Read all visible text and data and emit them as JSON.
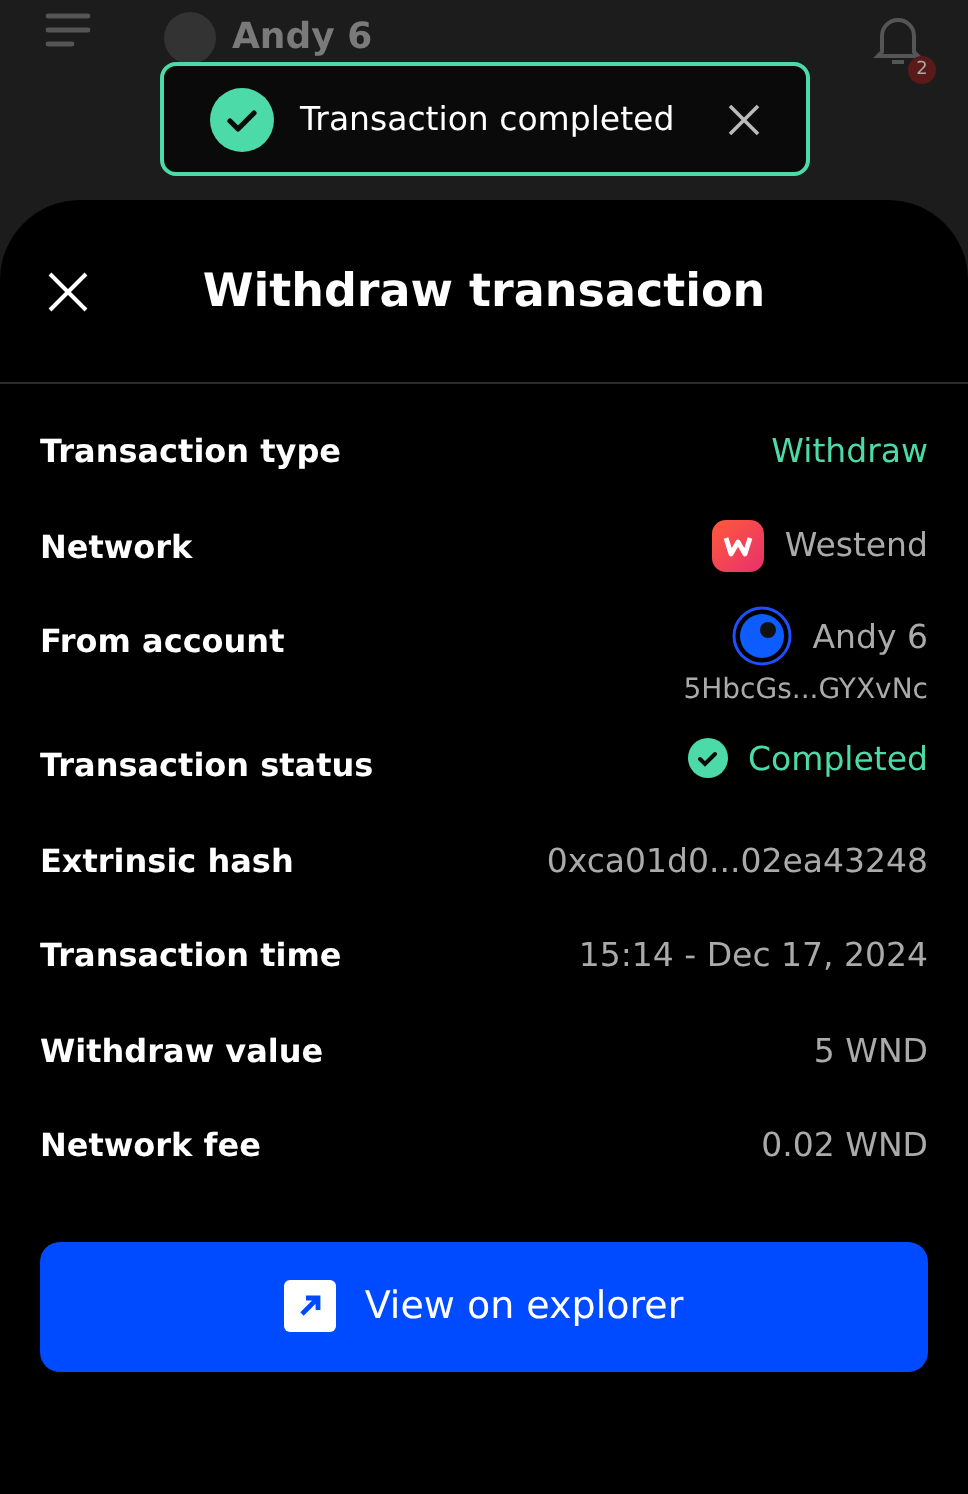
{
  "header": {
    "account_name": "Andy 6",
    "notification_count": "2"
  },
  "toast": {
    "message": "Transaction completed"
  },
  "sheet": {
    "title": "Withdraw transaction",
    "rows": [
      {
        "kind": "accent",
        "label": "Transaction type",
        "value": "Withdraw"
      },
      {
        "kind": "network",
        "label": "Network",
        "value": "Westend"
      },
      {
        "kind": "account",
        "label": "From account",
        "value": "Andy 6",
        "address": "5HbcGs...GYXvNc"
      },
      {
        "kind": "status",
        "label": "Transaction status",
        "value": "Completed"
      },
      {
        "kind": "plain",
        "label": "Extrinsic hash",
        "value": "0xca01d0...02ea43248"
      },
      {
        "kind": "plain",
        "label": "Transaction time",
        "value": "15:14 - Dec 17, 2024"
      },
      {
        "kind": "plain",
        "label": "Withdraw value",
        "value": "5 WND"
      },
      {
        "kind": "plain",
        "label": "Network fee",
        "value": "0.02 WND"
      }
    ],
    "button": "View on explorer"
  }
}
